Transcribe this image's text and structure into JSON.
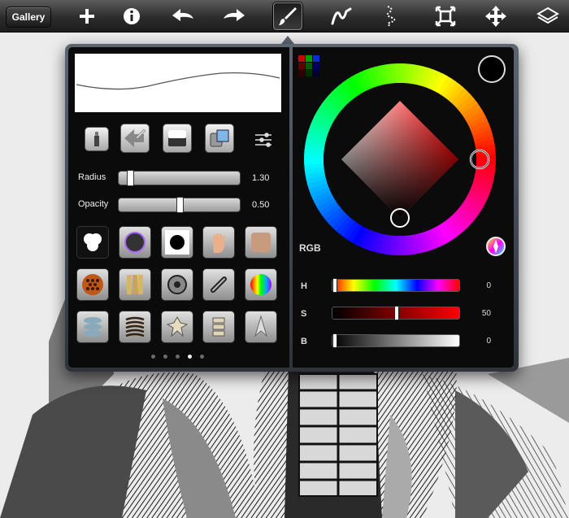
{
  "toolbar": {
    "gallery_label": "Gallery",
    "icons": [
      "plus-icon",
      "info-icon",
      "undo-icon",
      "redo-icon",
      "brush-icon",
      "smudge-icon",
      "eraser-icon",
      "transform-icon",
      "move-icon",
      "layers-icon"
    ],
    "active_tool": "brush-icon"
  },
  "brush_settings": {
    "radius_label": "Radius",
    "radius_value": "1.30",
    "radius_fraction": 0.07,
    "opacity_label": "Opacity",
    "opacity_value": "0.50",
    "opacity_fraction": 0.5,
    "brush_rows": [
      [
        "blob-brush",
        "ring-brush",
        "soft-dot-brush",
        "hand-brush",
        "skin-texture-brush"
      ],
      [
        "honeycomb-brush",
        "bamboo-brush",
        "gear-brush",
        "chain-brush",
        "rainbow-brush"
      ],
      [
        "spine-brush",
        "ribcage-brush",
        "vertebra-brush",
        "bone-brush",
        "spike-brush"
      ]
    ],
    "pages": 5,
    "active_page": 3
  },
  "color_panel": {
    "mode_label": "RGB",
    "h_label": "H",
    "h_value": "0",
    "h_fraction": 0.0,
    "s_label": "S",
    "s_value": "50",
    "s_fraction": 0.5,
    "b_label": "B",
    "b_value": "0",
    "b_fraction": 0.0,
    "current_color": "#000000",
    "swatches": [
      "#d00000",
      "#00a000",
      "#0030d0",
      "#600000",
      "#006000",
      "#000060",
      "#300000",
      "#003000",
      "#000030"
    ]
  }
}
